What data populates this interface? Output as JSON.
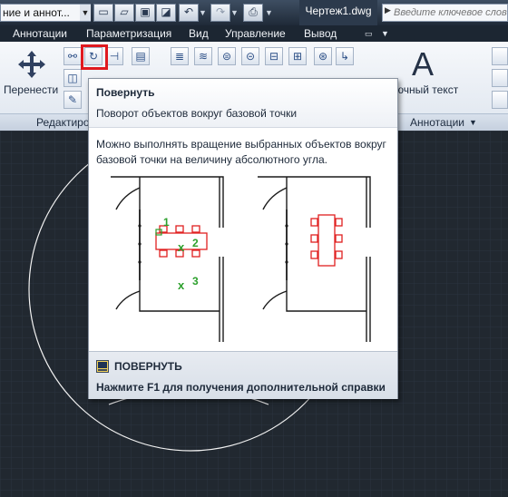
{
  "titlebar": {
    "workspace_value": "ние и аннот...",
    "document_title": "Чертеж1.dwg",
    "search_placeholder": "Введите ключевое слово/фразу"
  },
  "menu": {
    "tabs": [
      "Аннотации",
      "Параметризация",
      "Вид",
      "Управление",
      "Вывод"
    ]
  },
  "ribbon": {
    "move_label": "Перенести",
    "modify_panel_title": "Редактиро",
    "mtext_label": "ючный текст",
    "annotation_panel_title": "Аннотации",
    "rotate_highlight_color": "#e0191f"
  },
  "tooltip": {
    "title": "Повернуть",
    "description": "Поворот объектов вокруг базовой точки",
    "body": "Можно выполнять вращение выбранных объектов вокруг базовой точки на величину абсолютного угла.",
    "markers": [
      "1",
      "2",
      "3"
    ],
    "command_name": "ПОВЕРНУТЬ",
    "help_hint": "Нажмите F1 для получения дополнительной справки"
  },
  "colors": {
    "canvas": "#212830",
    "illustration_red": "#e02020",
    "illustration_green": "#2ca02c"
  },
  "icons": {
    "move": "move-arrows-icon",
    "rotate": "rotate-icon",
    "command": "command-line-icon"
  }
}
